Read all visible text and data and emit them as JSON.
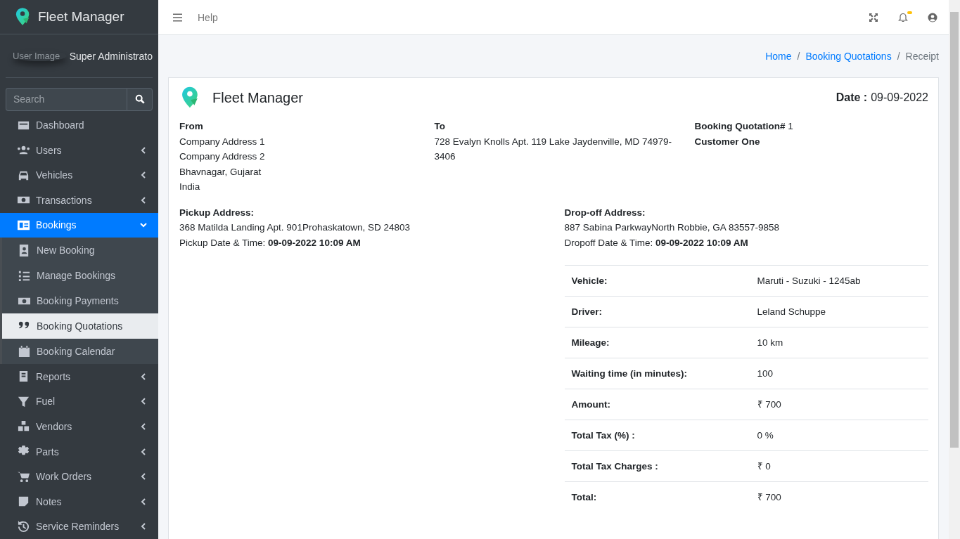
{
  "sidebar": {
    "brand": "Fleet Manager",
    "user_image_alt": "User Image",
    "user_name": "Super Administrato",
    "search": {
      "placeholder": "Search"
    },
    "items": [
      {
        "label": "Dashboard",
        "expandable": false,
        "selected": false
      },
      {
        "label": "Users",
        "expandable": true,
        "expanded": false,
        "selected": false
      },
      {
        "label": "Vehicles",
        "expandable": true,
        "expanded": false,
        "selected": false
      },
      {
        "label": "Transactions",
        "expandable": true,
        "expanded": false,
        "selected": false
      },
      {
        "label": "Bookings",
        "expandable": true,
        "expanded": true,
        "selected": true,
        "children": [
          {
            "label": "New Booking",
            "selected": false
          },
          {
            "label": "Manage Bookings",
            "selected": false
          },
          {
            "label": "Booking Payments",
            "selected": false
          },
          {
            "label": "Booking Quotations",
            "selected": true
          },
          {
            "label": "Booking Calendar",
            "selected": false
          }
        ]
      },
      {
        "label": "Reports",
        "expandable": true,
        "expanded": false,
        "selected": false
      },
      {
        "label": "Fuel",
        "expandable": true,
        "expanded": false,
        "selected": false
      },
      {
        "label": "Vendors",
        "expandable": true,
        "expanded": false,
        "selected": false
      },
      {
        "label": "Parts",
        "expandable": true,
        "expanded": false,
        "selected": false
      },
      {
        "label": "Work Orders",
        "expandable": true,
        "expanded": false,
        "selected": false
      },
      {
        "label": "Notes",
        "expandable": true,
        "expanded": false,
        "selected": false
      },
      {
        "label": "Service Reminders",
        "expandable": true,
        "expanded": false,
        "selected": false
      }
    ]
  },
  "topbar": {
    "help": "Help",
    "notifications_unread": true
  },
  "breadcrumb": {
    "separator": "/",
    "items": [
      {
        "label": "Home",
        "current": false
      },
      {
        "label": "Booking Quotations",
        "current": false
      },
      {
        "label": "Receipt",
        "current": true
      }
    ]
  },
  "receipt": {
    "brand": "Fleet Manager",
    "date_label": "Date :",
    "date": "09-09-2022",
    "from": {
      "label": "From",
      "lines": [
        "Company Address 1",
        "Company Address 2",
        "Bhavnagar, Gujarat",
        "India"
      ]
    },
    "to": {
      "label": "To",
      "lines": [
        "728 Evalyn Knolls Apt. 119 Lake Jaydenville, MD 74979-3406"
      ]
    },
    "quotation": {
      "number": "**Booking Quotation#** 1",
      "customer": "Customer One"
    },
    "pickup": {
      "label": "Pickup Address:",
      "address": "368 Matilda Landing Apt. 901Prohaskatown, SD 24803",
      "datetime": "Pickup Date & Time: **09-09-2022 10:09 AM**"
    },
    "dropoff": {
      "label": "Drop-off Address:",
      "address": "887 Sabina ParkwayNorth Robbie, GA 83557-9858",
      "datetime": "Dropoff Date & Time: **09-09-2022 10:09 AM**"
    },
    "details": [
      {
        "label": "Vehicle:",
        "value": "Maruti - Suzuki - 1245ab"
      },
      {
        "label": "Driver:",
        "value": "Leland Schuppe"
      },
      {
        "label": "Mileage:",
        "value": "10 km"
      },
      {
        "label": "Waiting time (in minutes):",
        "value": "100"
      },
      {
        "label": "Amount:",
        "value": "₹ 700"
      },
      {
        "label": "Total Tax (%) :",
        "value": "0 %"
      },
      {
        "label": "Total Tax Charges :",
        "value": "₹ 0"
      },
      {
        "label": "Total:",
        "value": "₹ 700"
      }
    ]
  }
}
